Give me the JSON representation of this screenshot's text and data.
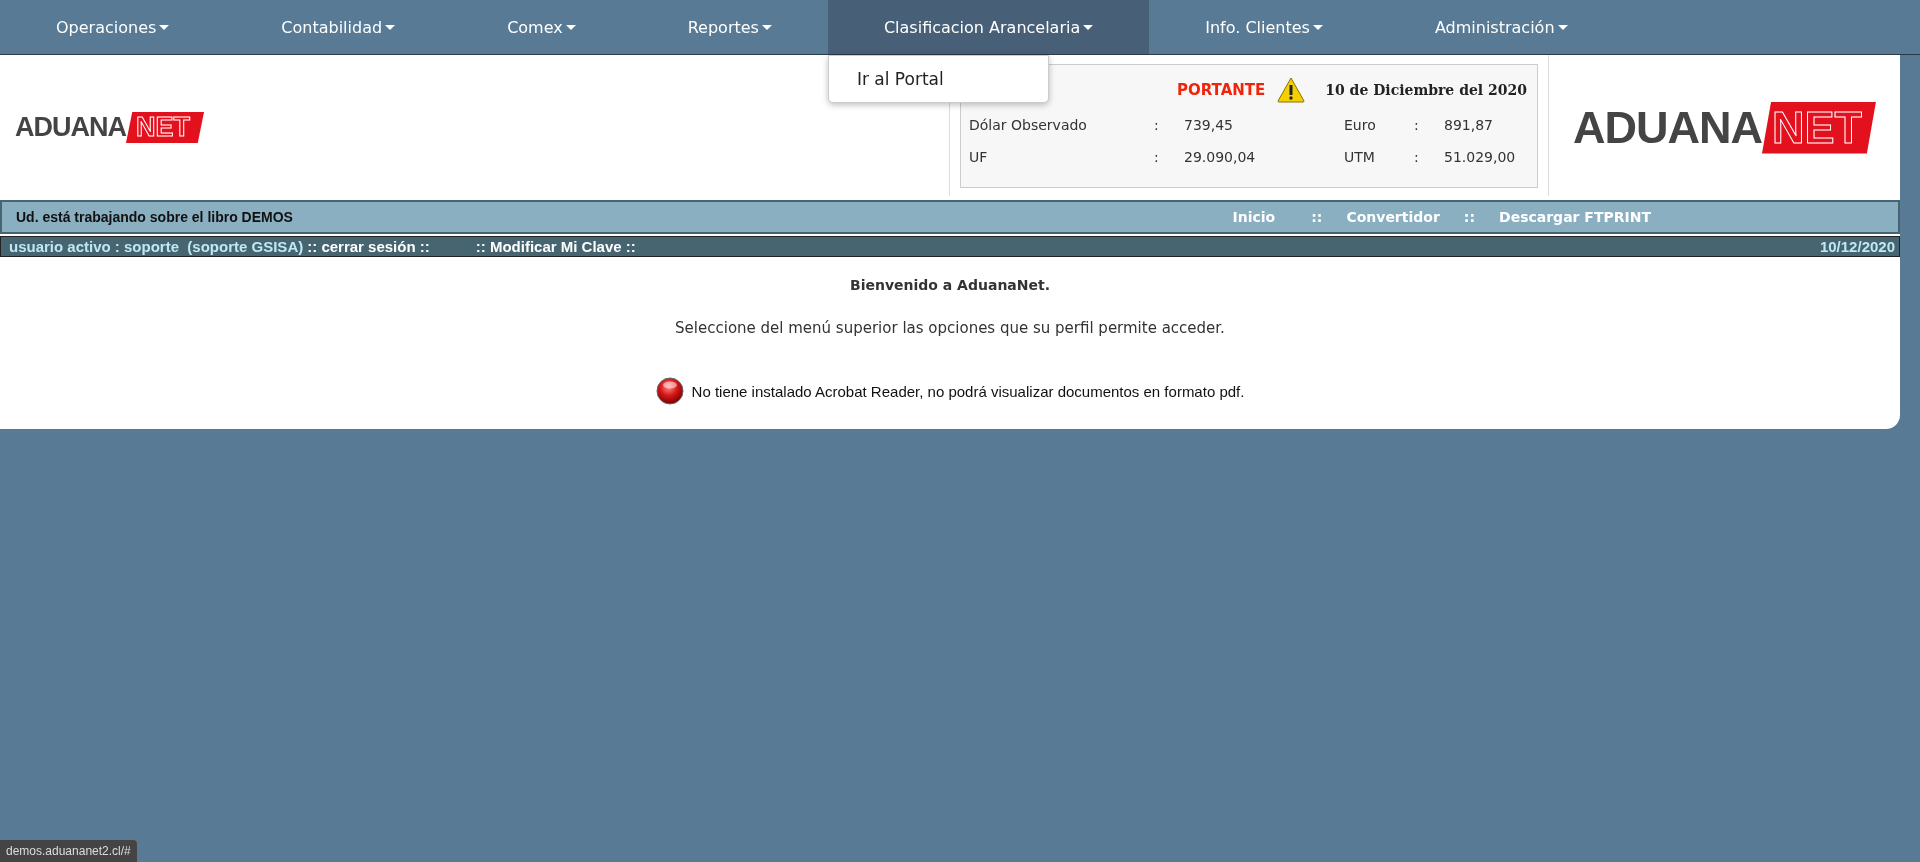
{
  "nav": [
    {
      "label": "Operaciones",
      "selected": false
    },
    {
      "label": "Contabilidad",
      "selected": false
    },
    {
      "label": "Comex",
      "selected": false
    },
    {
      "label": "Reportes",
      "selected": false
    },
    {
      "label": "Clasificacion Arancelaria",
      "selected": true
    },
    {
      "label": "Info. Clientes",
      "selected": false
    },
    {
      "label": "Administración",
      "selected": false
    }
  ],
  "dropdown": {
    "items": [
      "Ir al Portal"
    ]
  },
  "logo_left": {
    "word": "ADUANA",
    "badge": "NET"
  },
  "notice": {
    "label": "PORTANTE",
    "date": "10 de Diciembre del 2020"
  },
  "rates": [
    {
      "name": "Dólar Observado",
      "sep": ":",
      "value": "739,45"
    },
    {
      "name": "Euro",
      "sep": ":",
      "value": "891,87"
    },
    {
      "name": "UF",
      "sep": ":",
      "value": "29.090,04"
    },
    {
      "name": "UTM",
      "sep": ":",
      "value": "51.029,00"
    }
  ],
  "logo_right": {
    "word": "ADUANA",
    "badge": "NET"
  },
  "book_bar": {
    "text": "Ud. está trabajando sobre el libro DEMOS",
    "items": [
      {
        "kind": "link",
        "text": "Inicio"
      },
      {
        "kind": "sep",
        "text": "::"
      },
      {
        "kind": "link",
        "text": "Convertidor"
      },
      {
        "kind": "sep",
        "text": "::"
      },
      {
        "kind": "link",
        "text": "Descargar FTPRINT"
      }
    ]
  },
  "user_bar": {
    "items": [
      {
        "kind": "info",
        "text": "usuario activo : soporte  (soporte GSISA)"
      },
      {
        "kind": "link",
        "text": ":: cerrar sesión ::"
      },
      {
        "kind": "link",
        "text": ":: Modificar Mi Clave ::"
      }
    ],
    "date": "10/12/2020"
  },
  "welcome": {
    "title": "Bienvenido a AduanaNet.",
    "subtitle": "Seleccione del menú superior las opciones que su perfil permite acceder.",
    "warning": "No tiene instalado Acrobat Reader, no podrá visualizar documentos en formato pdf."
  },
  "status_url": "demos.aduananet2.cl/#"
}
